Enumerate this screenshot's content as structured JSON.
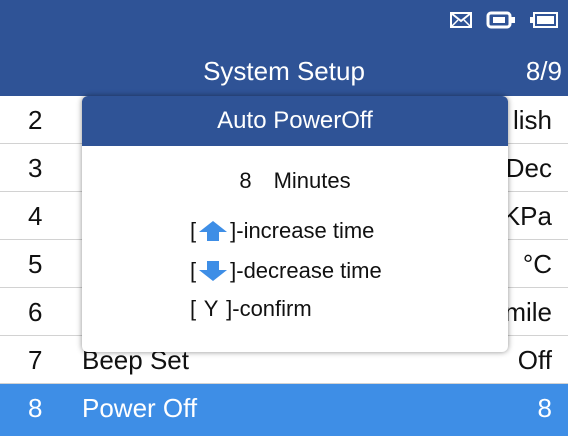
{
  "header": {
    "title": "System Setup",
    "page_indicator": "8/9",
    "status_icons": [
      "mail-icon",
      "battery-connector-icon",
      "battery-icon"
    ]
  },
  "menu": {
    "rows": [
      {
        "num": "2",
        "label": "",
        "value": "lish"
      },
      {
        "num": "3",
        "label": "",
        "value": "Dec"
      },
      {
        "num": "4",
        "label": "",
        "value": "KPa"
      },
      {
        "num": "5",
        "label": "",
        "value": "°C"
      },
      {
        "num": "6",
        "label": "",
        "value": "mile"
      },
      {
        "num": "7",
        "label": "Beep Set",
        "value": "Off"
      },
      {
        "num": "8",
        "label": "Power Off",
        "value": "8"
      }
    ],
    "selected_index": 6
  },
  "popup": {
    "title": "Auto PowerOff",
    "minutes_value": "8",
    "minutes_unit": "Minutes",
    "open_bracket": "[",
    "increase_text": "]-increase time",
    "decrease_text": "]-decrease time",
    "confirm_key": "Y",
    "confirm_text": "]-confirm"
  },
  "colors": {
    "header_bg": "#2f5396",
    "selected_bg": "#3e8ee6",
    "arrow_color": "#3e8ee6"
  }
}
